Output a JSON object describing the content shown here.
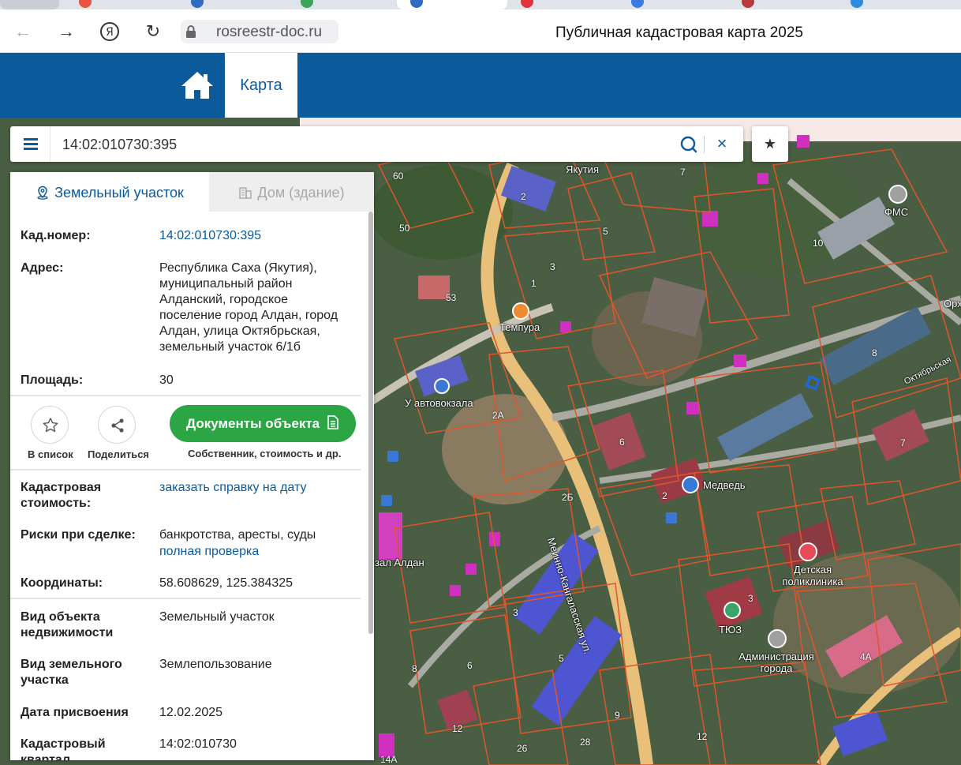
{
  "browser": {
    "url": "rosreestr-doc.ru",
    "page_title": "Публичная кадастровая карта 2025"
  },
  "header": {
    "map_tab": "Карта"
  },
  "search": {
    "value": "14:02:010730:395"
  },
  "panel": {
    "tabs": [
      "Земельный участок",
      "Дом (здание)"
    ],
    "rows_top": [
      {
        "label": "Кад.номер:",
        "value": "14:02:010730:395"
      },
      {
        "label": "Адрес:",
        "value": "Республика Саха (Якутия), муниципальный район Алданский, городское поселение город Алдан, город Алдан, улица Октябрьская, земельный участок 6/1б"
      },
      {
        "label": "Площадь:",
        "value": "30"
      }
    ],
    "actions": {
      "add_list": "В список",
      "share": "Поделиться",
      "docs_button": "Документы объекта",
      "docs_sub": "Собственник, стоимость и др."
    },
    "rows_mid": [
      {
        "label": "Кадастровая стоимость:",
        "value": "заказать справку на дату"
      },
      {
        "label": "Риски при сделке:",
        "value": "банкротства, аресты, суды",
        "link": "полная проверка"
      },
      {
        "label": "Координаты:",
        "value": "58.608629, 125.384325"
      }
    ],
    "rows_bottom": [
      {
        "label": "Вид объекта недвижимости",
        "value": "Земельный участок"
      },
      {
        "label": "Вид земельного участка",
        "value": "Землепользование"
      },
      {
        "label": "Дата присвоения",
        "value": "12.02.2025"
      },
      {
        "label": "Кадастровый квартал",
        "value": "14:02:010730"
      }
    ]
  },
  "map": {
    "labels": [
      "Якутия",
      "ФМС",
      "Темпура",
      "У автовокзала",
      "Медведь",
      "Детская поликлиника",
      "ТЮЗ",
      "Администрация города",
      "Меинно-Кангаласская ул.",
      "Октябрьская",
      "зал Алдан",
      "Орх"
    ],
    "numbers": [
      "60",
      "50",
      "53",
      "2",
      "7",
      "5",
      "3",
      "1",
      "10",
      "8",
      "6",
      "2А",
      "2Б",
      "3",
      "5",
      "7",
      "4А",
      "8",
      "6",
      "12",
      "26",
      "28",
      "9",
      "12",
      "3",
      "14А",
      "2"
    ]
  }
}
